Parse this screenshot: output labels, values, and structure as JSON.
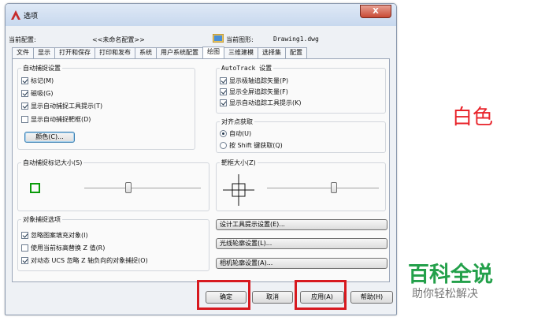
{
  "window": {
    "title": "选项",
    "close_label": "X"
  },
  "info": {
    "profile_label": "当前配置:",
    "profile_value": "<<未命名配置>>",
    "drawing_label": "当前图形:",
    "drawing_value": "Drawing1.dwg"
  },
  "tabs": [
    {
      "label": "文件"
    },
    {
      "label": "显示"
    },
    {
      "label": "打开和保存"
    },
    {
      "label": "打印和发布"
    },
    {
      "label": "系统"
    },
    {
      "label": "用户系统配置"
    },
    {
      "label": "绘图",
      "active": true
    },
    {
      "label": "三维建模"
    },
    {
      "label": "选择集"
    },
    {
      "label": "配置"
    }
  ],
  "autosnap": {
    "title": "自动捕捉设置",
    "marker": {
      "label": "标记(M)",
      "checked": true
    },
    "magnet": {
      "label": "磁吸(G)",
      "checked": true
    },
    "tooltip": {
      "label": "显示自动捕捉工具提示(T)",
      "checked": true
    },
    "aperture": {
      "label": "显示自动捕捉靶框(D)",
      "checked": false
    },
    "color_button": "颜色(C)..."
  },
  "autotrack": {
    "title": "AutoTrack 设置",
    "polar": {
      "label": "显示极轴追踪矢量(P)",
      "checked": true
    },
    "fullscreen": {
      "label": "显示全屏追踪矢量(F)",
      "checked": true
    },
    "tooltip": {
      "label": "显示自动追踪工具提示(K)",
      "checked": true
    }
  },
  "alignment": {
    "title": "对齐点获取",
    "auto": {
      "label": "自动(U)",
      "selected": true
    },
    "shift": {
      "label": "按 Shift 键获取(Q)",
      "selected": false
    }
  },
  "marker_size": {
    "title": "自动捕捉标记大小(S)",
    "slider_fraction": 0.38
  },
  "aperture_size": {
    "title": "靶框大小(Z)",
    "slider_fraction": 0.6
  },
  "object_snap": {
    "title": "对象捕捉选项",
    "ignore_hatch": {
      "label": "忽略图案填充对象(I)",
      "checked": true
    },
    "replace_z": {
      "label": "使用当前标高替换 Z 值(R)",
      "checked": false
    },
    "ignore_negative_z": {
      "label": "对动态 UCS 忽略 Z 轴负向的对象捕捉(O)",
      "checked": true
    }
  },
  "side_buttons": {
    "drafting_tooltip": "设计工具提示设置(E)...",
    "lights_glyph": "光线轮廓设置(L)...",
    "camera_glyph": "相机轮廓设置(A)..."
  },
  "footer": {
    "ok": "确定",
    "cancel": "取消",
    "apply": "应用(A)",
    "help": "帮助(H)"
  },
  "overlays": {
    "white_label": "白色",
    "watermark_title": "百科全说",
    "watermark_subtitle": "助你轻松解决"
  },
  "colors": {
    "highlight": "#d7191f",
    "marker": "#0a9b0a",
    "watermark": "#23a04a",
    "annotation": "#e8232a"
  }
}
